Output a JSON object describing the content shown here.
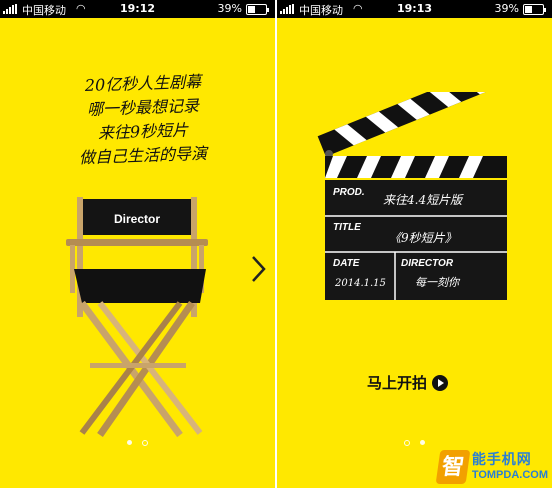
{
  "left_screen": {
    "status": {
      "carrier": "中国移动",
      "time": "19:12",
      "battery": "39%",
      "battery_level": 0.39
    },
    "poem": [
      "20亿秒人生剧幕",
      "哪一秒最想记录",
      "来往9秒短片",
      "做自己生活的导演"
    ],
    "chair_label": "Director",
    "page_indicator": {
      "count": 2,
      "active": 0
    }
  },
  "right_screen": {
    "status": {
      "carrier": "中国移动",
      "time": "19:13",
      "battery": "39%",
      "battery_level": 0.39
    },
    "clapper": {
      "prod_caption": "PROD.",
      "prod_value": "来往4.4短片版",
      "title_caption": "TITLE",
      "title_value": "《9秒短片》",
      "date_caption": "DATE",
      "date_value": "2014.1.15",
      "director_caption": "DIRECTOR",
      "director_value": "每一刻你"
    },
    "start_button": "马上开拍",
    "page_indicator": {
      "count": 2,
      "active": 1
    }
  },
  "watermark": {
    "logo": "智",
    "line1": "能手机网",
    "line2": "TOMPDA.COM"
  },
  "colors": {
    "background": "#ffe800",
    "status_bar": "#000000",
    "ink": "#111111"
  }
}
